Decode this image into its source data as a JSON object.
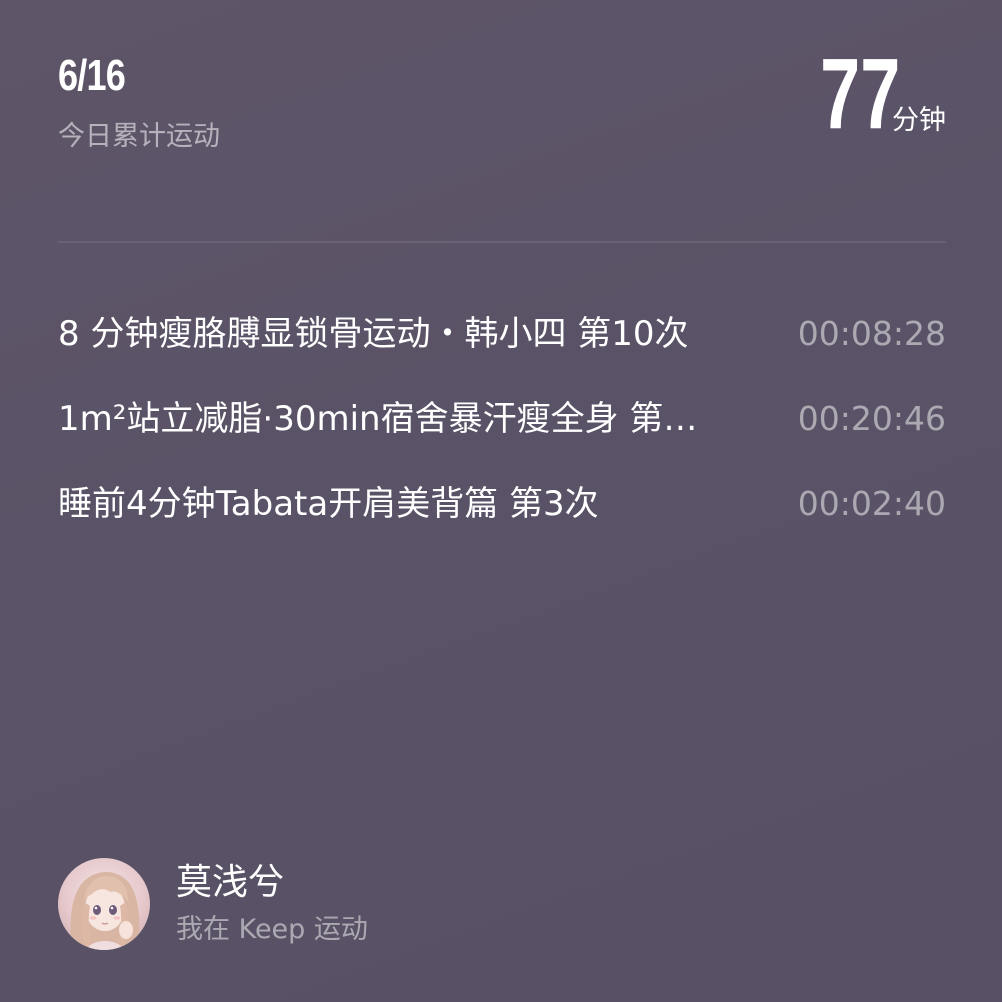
{
  "summary": {
    "date": "6/16",
    "date_label": "今日累计运动",
    "total_value": "77",
    "total_unit": "分钟"
  },
  "workouts": [
    {
      "title": "8 分钟瘦胳膊显锁骨运动・韩小四 第10次",
      "duration": "00:08:28"
    },
    {
      "title": "1m²站立减脂·30min宿舍暴汗瘦全身 第…",
      "duration": "00:20:46"
    },
    {
      "title": "睡前4分钟Tabata开肩美背篇 第3次",
      "duration": "00:02:40"
    }
  ],
  "user": {
    "name": "莫浅兮",
    "subtitle": "我在 Keep 运动",
    "avatar_icon": "anime-girl-avatar"
  },
  "colors": {
    "background": "#5b5367",
    "text_primary": "#ffffff",
    "text_secondary": "rgba(255,255,255,0.5)"
  }
}
